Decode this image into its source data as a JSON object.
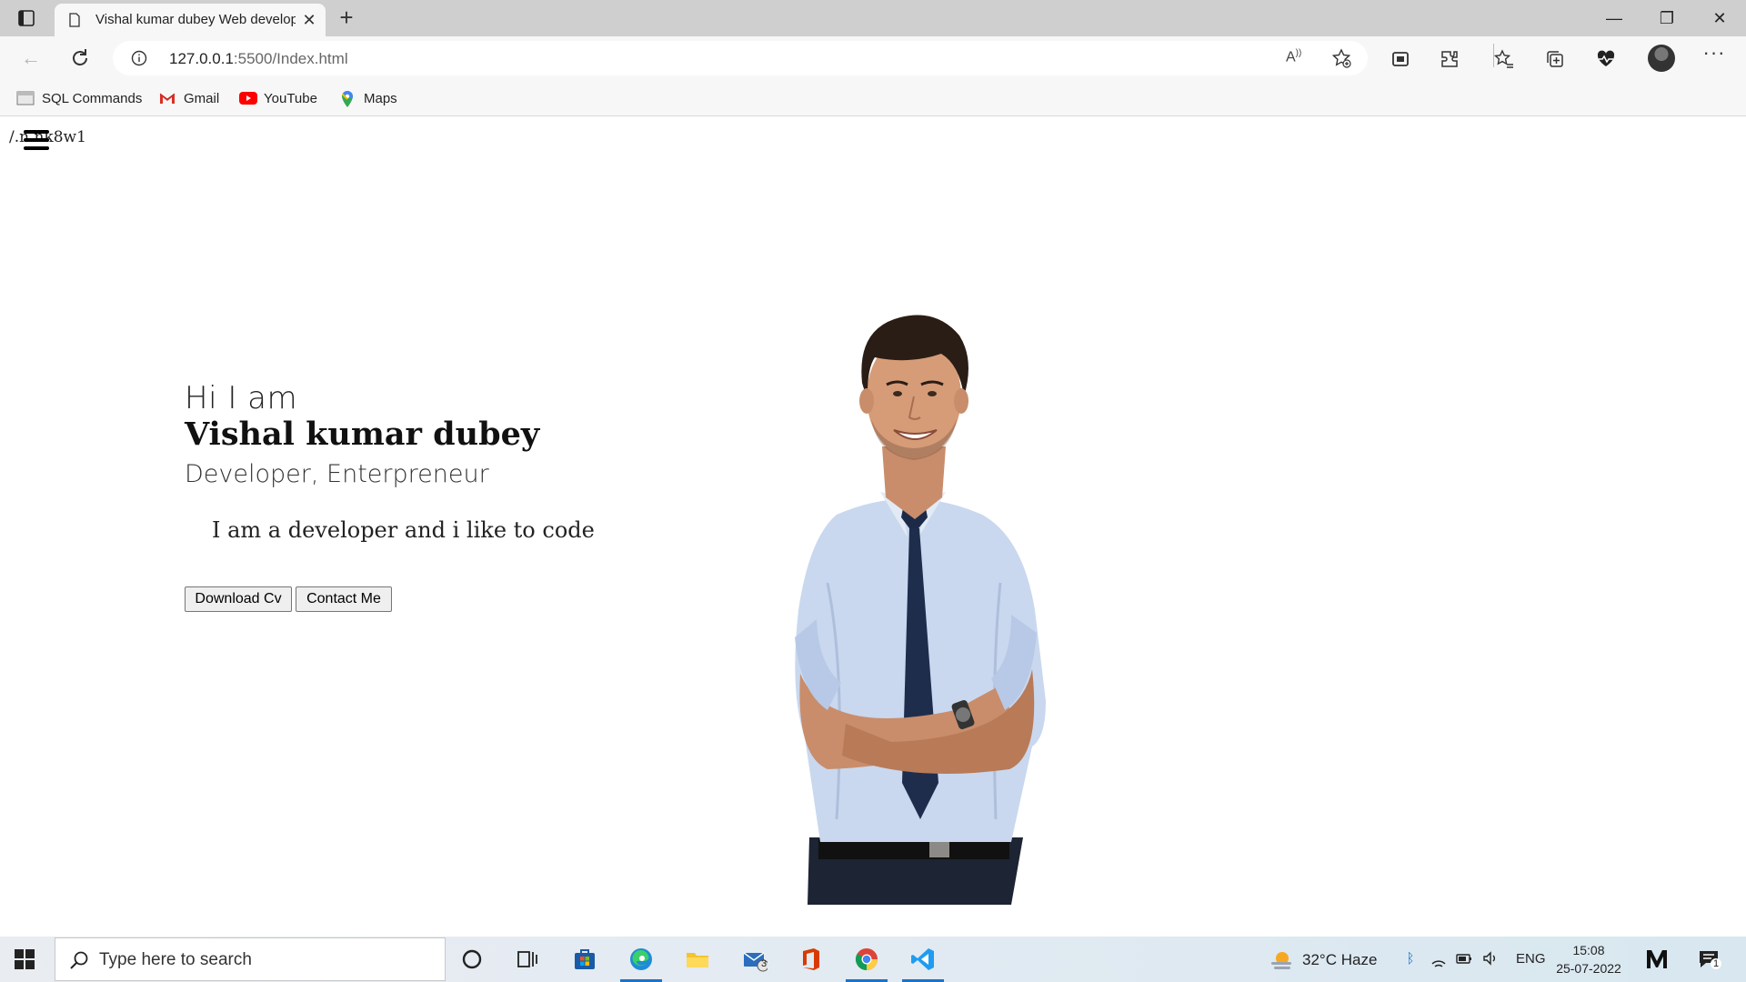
{
  "browser": {
    "tab_title": "Vishal kumar dubey Web developer",
    "tab_close": "✕",
    "new_tab": "+",
    "url_host": "127.0.0.1",
    "url_path": ":5500/Index.html",
    "read_aloud": "Á͖",
    "more": "···"
  },
  "bookmarks": [
    {
      "label": "SQL Commands",
      "icon": "folder-icon"
    },
    {
      "label": "Gmail",
      "icon": "gmail-icon"
    },
    {
      "label": "YouTube",
      "icon": "youtube-icon"
    },
    {
      "label": "Maps",
      "icon": "maps-icon"
    }
  ],
  "page": {
    "broken_image_alt": "/.n nk8w1",
    "greeting": "Hi I am",
    "name": "Vishal kumar dubey",
    "roles": "Developer, Enterpreneur",
    "tagline": "I am a developer and i like to code",
    "download_btn": "Download Cv",
    "contact_btn": "Contact Me"
  },
  "taskbar": {
    "search_placeholder": "Type here to search",
    "mail_badge": "3",
    "weather": "32°C  Haze",
    "lang": "ENG",
    "time": "15:08",
    "date": "25-07-2022",
    "notif_count": "1"
  },
  "colors": {
    "accent": "#1a73c8",
    "chrome_bg": "#f7f7f7",
    "tabbar_bg": "#cfcfcf"
  }
}
